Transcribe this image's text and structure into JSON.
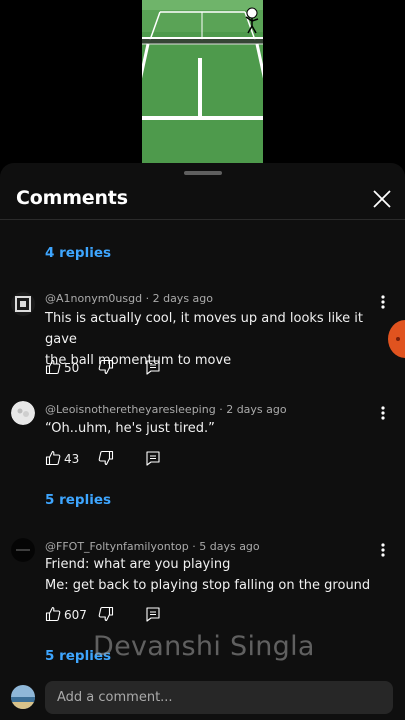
{
  "sheet": {
    "title": "Comments"
  },
  "replies_links": [
    "4 replies",
    "5 replies",
    "5 replies"
  ],
  "comments": [
    {
      "author": "@A1nonym0usgd",
      "age": "2 days ago",
      "text_lines": [
        "This is actually cool, it moves up and looks like it gave",
        "the ball momentum to move"
      ],
      "likes": "50"
    },
    {
      "author": "@Leoisnotheretheyaresleeping",
      "age": "2 days ago",
      "text_lines": [
        "“Oh..uhm, he's just tired.”"
      ],
      "likes": "43"
    },
    {
      "author": "@FFOT_Foltynfamilyontop",
      "age": "5 days ago",
      "text_lines": [
        "Friend: what are you playing",
        "Me: get back to playing stop falling on the ground"
      ],
      "likes": "607"
    }
  ],
  "meta_separator": " · ",
  "composer": {
    "placeholder": "Add a comment..."
  },
  "watermark": "Devanshi Singla",
  "colors": {
    "background": "#0f0f0f",
    "link": "#3ea6ff",
    "court": "#4f9a4d"
  }
}
